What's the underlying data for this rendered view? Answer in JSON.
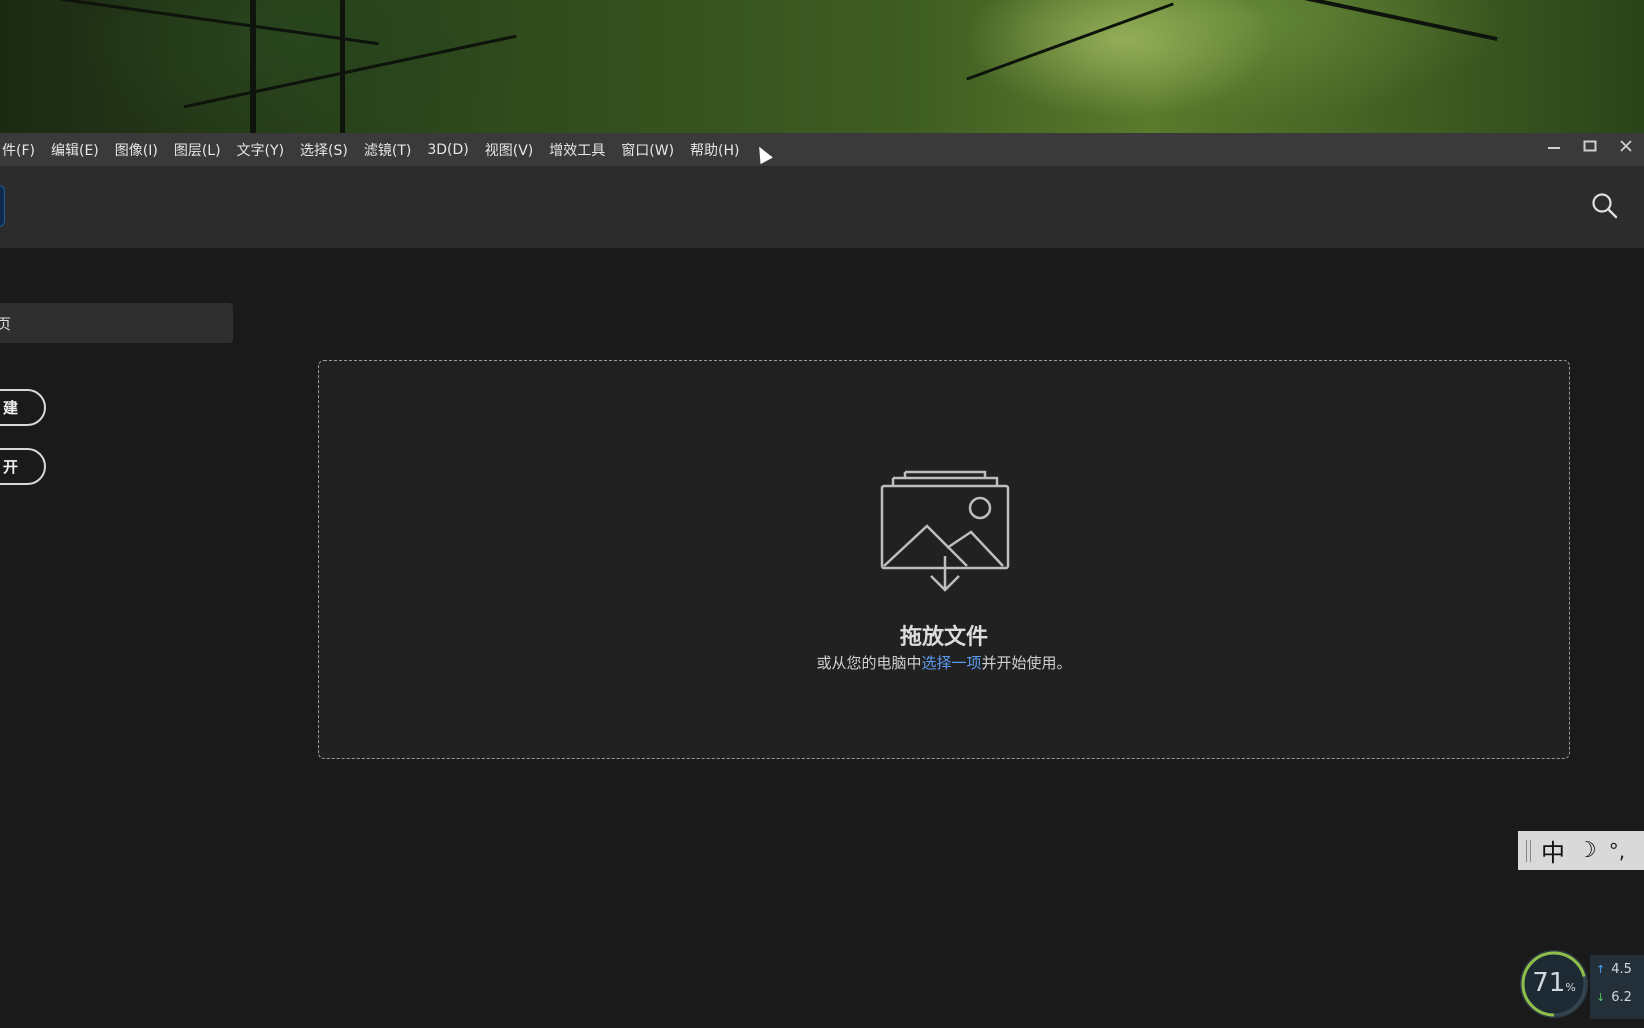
{
  "menubar": {
    "items": [
      "件(F)",
      "编辑(E)",
      "图像(I)",
      "图层(L)",
      "文字(Y)",
      "选择(S)",
      "滤镜(T)",
      "3D(D)",
      "视图(V)",
      "增效工具",
      "窗口(W)",
      "帮助(H)"
    ],
    "window_controls": [
      "minimize-icon",
      "restore-icon",
      "close-icon"
    ]
  },
  "toolbar": {
    "search_icon": "search-icon"
  },
  "sidebar": {
    "home_label": "页",
    "new_button": "建",
    "open_button": "开"
  },
  "dropzone": {
    "title": "拖放文件",
    "subtitle_prefix": "或从您的电脑中",
    "subtitle_link": "选择一项",
    "subtitle_suffix": "并开始使用。",
    "icon": "image-drop-icon"
  },
  "ime": {
    "mode": "中",
    "moon": "☽",
    "punct": "°,"
  },
  "system_monitor": {
    "cpu_percent": 71,
    "cpu_unit": "%",
    "upload": "4.5",
    "download": "6.2"
  },
  "colors": {
    "link": "#5b9bf0",
    "background": "#1a1a1a",
    "toolbar": "#2c2c2c",
    "menubar": "#3a3a3a"
  }
}
